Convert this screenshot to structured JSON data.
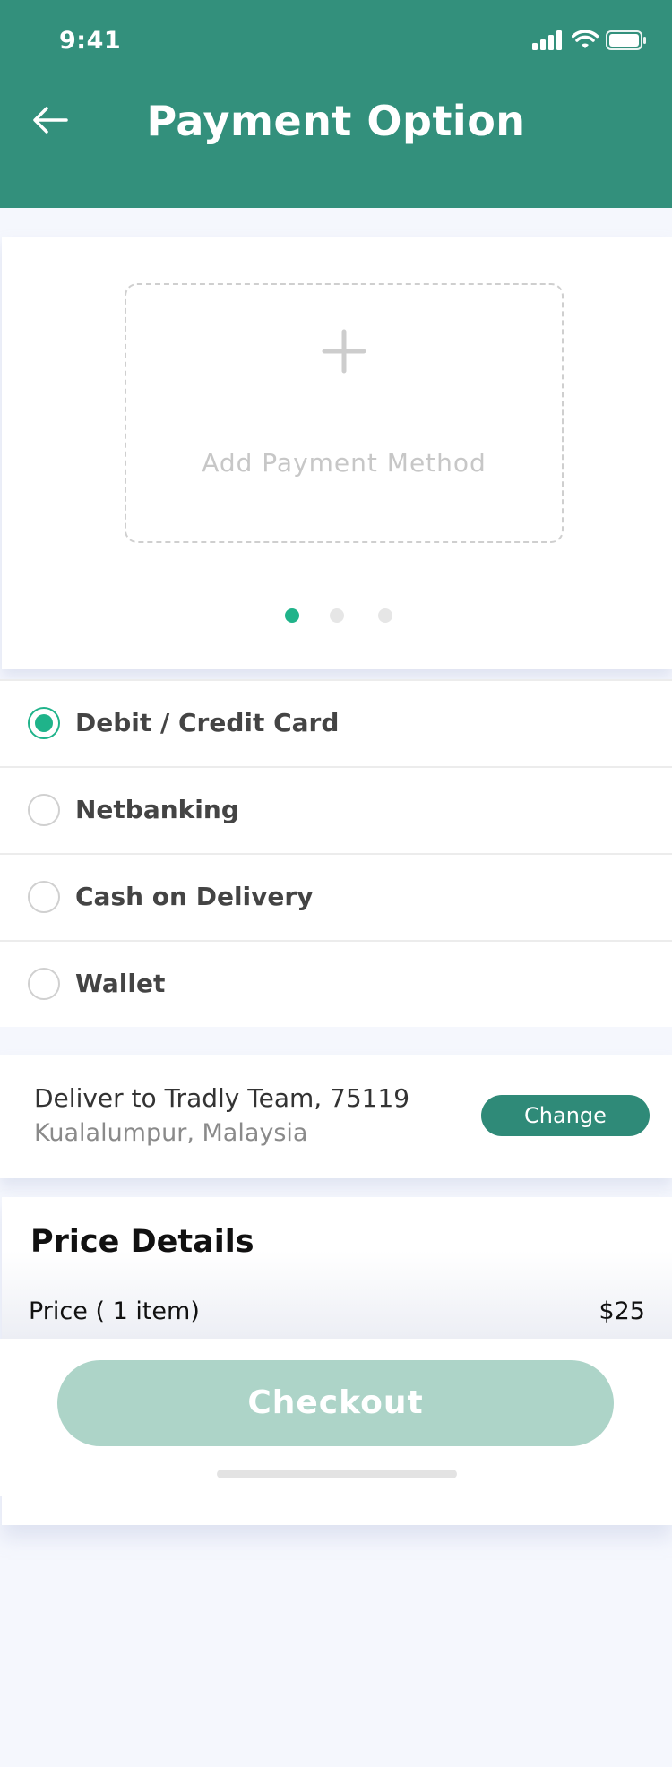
{
  "status_bar": {
    "time": "9:41"
  },
  "header": {
    "title": "Payment Option",
    "back_icon": "arrow-left-icon"
  },
  "payment_card": {
    "add_icon": "plus-icon",
    "add_label": "Add Payment Method",
    "pager_dots": 3,
    "active_dot": 0
  },
  "payment_options": [
    {
      "label": "Debit / Credit Card",
      "selected": true
    },
    {
      "label": "Netbanking",
      "selected": false
    },
    {
      "label": "Cash on Delivery",
      "selected": false
    },
    {
      "label": "Wallet",
      "selected": false
    }
  ],
  "delivery": {
    "line1": "Deliver to Tradly Team, 75119",
    "line2": "Kualalumpur, Malaysia",
    "change_label": "Change"
  },
  "price_details": {
    "title": "Price Details",
    "rows": [
      {
        "label": "Price ( 1 item)",
        "value": "$25"
      }
    ]
  },
  "checkout": {
    "label": "Checkout"
  },
  "colors": {
    "header": "#33907c",
    "accent": "#1fb38a",
    "change_button": "#2f8a78",
    "checkout_button": "#add4c8",
    "background": "#f5f7fd"
  }
}
